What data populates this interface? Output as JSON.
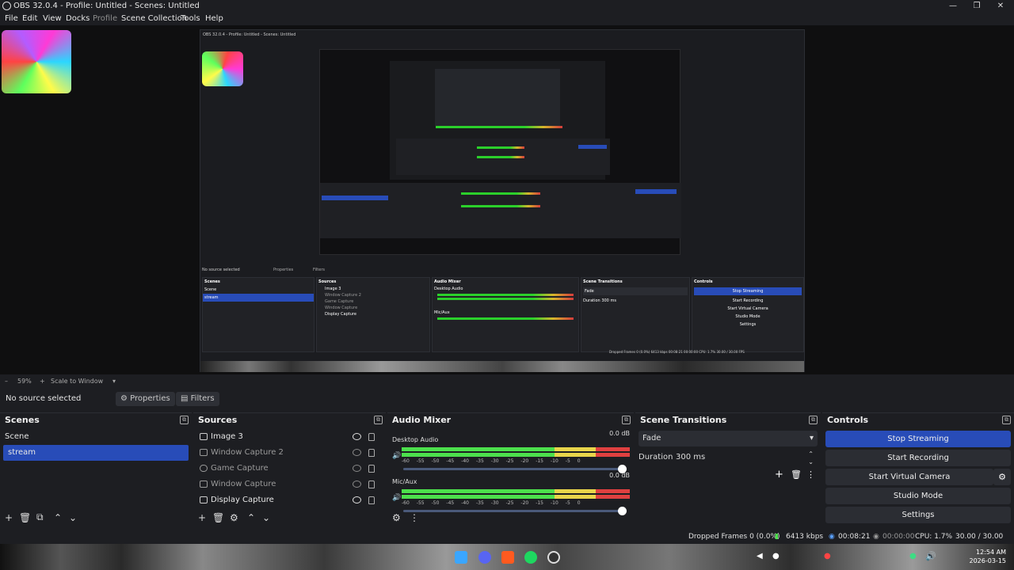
{
  "window": {
    "title": "OBS 32.0.4 - Profile: Untitled - Scenes: Untitled"
  },
  "menu": [
    "File",
    "Edit",
    "View",
    "Docks",
    "Profile",
    "Scene Collection",
    "Tools",
    "Help"
  ],
  "preview": {
    "zoom": "59%",
    "scale_mode": "Scale to Window",
    "nested": {
      "title": "OBS 32.0.4 - Profile: Untitled - Scenes: Untitled",
      "no_source": "No source selected",
      "properties": "Properties",
      "filters": "Filters",
      "scenes_header": "Scenes",
      "scenes": [
        "Scene",
        "stream"
      ],
      "sources_header": "Sources",
      "sources": [
        "Image 3",
        "Window Capture 2",
        "Game Capture",
        "Window Capture",
        "Display Capture"
      ],
      "audio_header": "Audio Mixer",
      "audio": [
        "Desktop Audio",
        "Mic/Aux"
      ],
      "transitions_header": "Scene Transitions",
      "transition": "Fade",
      "duration_label": "Duration",
      "duration": "300 ms",
      "controls_header": "Controls",
      "controls": [
        "Stop Streaming",
        "Start Recording",
        "Start Virtual Camera",
        "Studio Mode",
        "Settings"
      ],
      "status": "Dropped Frames 0 (0.0%)   6413 kbps   00:08:21   00:00:00   CPU: 1.7%   30.00 / 30.00 FPS"
    }
  },
  "source_bar": {
    "no_source": "No source selected",
    "properties": "Properties",
    "filters": "Filters"
  },
  "scenes": {
    "header": "Scenes",
    "items": [
      {
        "label": "Scene",
        "selected": false
      },
      {
        "label": "stream",
        "selected": true
      }
    ]
  },
  "sources": {
    "header": "Sources",
    "items": [
      {
        "label": "Image 3",
        "icon": "image-icon",
        "visible": true
      },
      {
        "label": "Window Capture 2",
        "icon": "window-icon",
        "visible": false
      },
      {
        "label": "Game Capture",
        "icon": "gamepad-icon",
        "visible": false
      },
      {
        "label": "Window Capture",
        "icon": "window-icon",
        "visible": false
      },
      {
        "label": "Display Capture",
        "icon": "monitor-icon",
        "visible": true
      }
    ]
  },
  "audio": {
    "header": "Audio Mixer",
    "channels": [
      {
        "name": "Desktop Audio",
        "db": "0.0 dB"
      },
      {
        "name": "Mic/Aux",
        "db": "0.0 dB"
      }
    ],
    "scale": [
      "-60",
      "-55",
      "-50",
      "-45",
      "-40",
      "-35",
      "-30",
      "-25",
      "-20",
      "-15",
      "-10",
      "-5",
      "0"
    ]
  },
  "transitions": {
    "header": "Scene Transitions",
    "selected": "Fade",
    "duration_label": "Duration",
    "duration": "300 ms"
  },
  "controls": {
    "header": "Controls",
    "buttons": [
      "Stop Streaming",
      "Start Recording",
      "Start Virtual Camera",
      "Studio Mode",
      "Settings"
    ]
  },
  "status": {
    "dropped": "Dropped Frames 0 (0.0%)",
    "kbps": "6413 kbps",
    "stream_time": "00:08:21",
    "rec_time": "00:00:00",
    "cpu": "CPU: 1.7%",
    "fps": "30.00 / 30.00 FPS"
  },
  "taskbar": {
    "time": "12:54 AM",
    "date": "2026-03-15"
  },
  "colors": {
    "accent": "#284cb8",
    "bg": "#1d1e22",
    "meter_green": "#4ce04c",
    "meter_yellow": "#e8d54a",
    "meter_red": "#e04040"
  }
}
